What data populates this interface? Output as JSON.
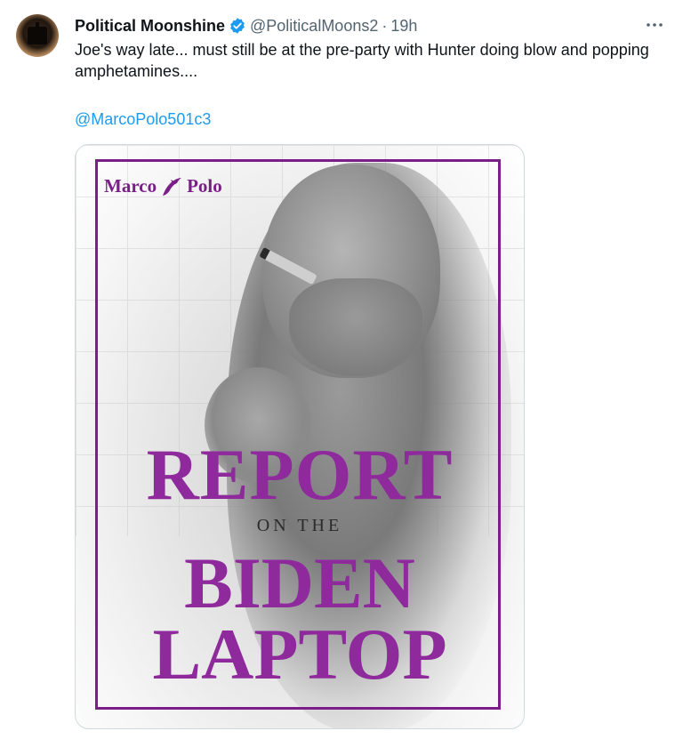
{
  "tweet": {
    "author_name": "Political Moonshine",
    "verified_icon": "verified-badge-icon",
    "handle": "@PoliticalMoons2",
    "separator": "·",
    "time": "19h",
    "more_icon": "more-horizontal-icon",
    "text": "Joe's way late... must still be at the pre-party with Hunter doing blow and popping amphetamines....",
    "mention": "@MarcoPolo501c3"
  },
  "cover": {
    "brand_left": "Marco",
    "brand_right": "Polo",
    "brand_icon": "dolphin-icon",
    "line1": "REPORT",
    "line2": "ON THE",
    "line3": "BIDEN",
    "line4": "LAPTOP"
  },
  "colors": {
    "accent_blue": "#1d9bf0",
    "cover_purple": "#8e2a9c",
    "muted_text": "#536471"
  }
}
